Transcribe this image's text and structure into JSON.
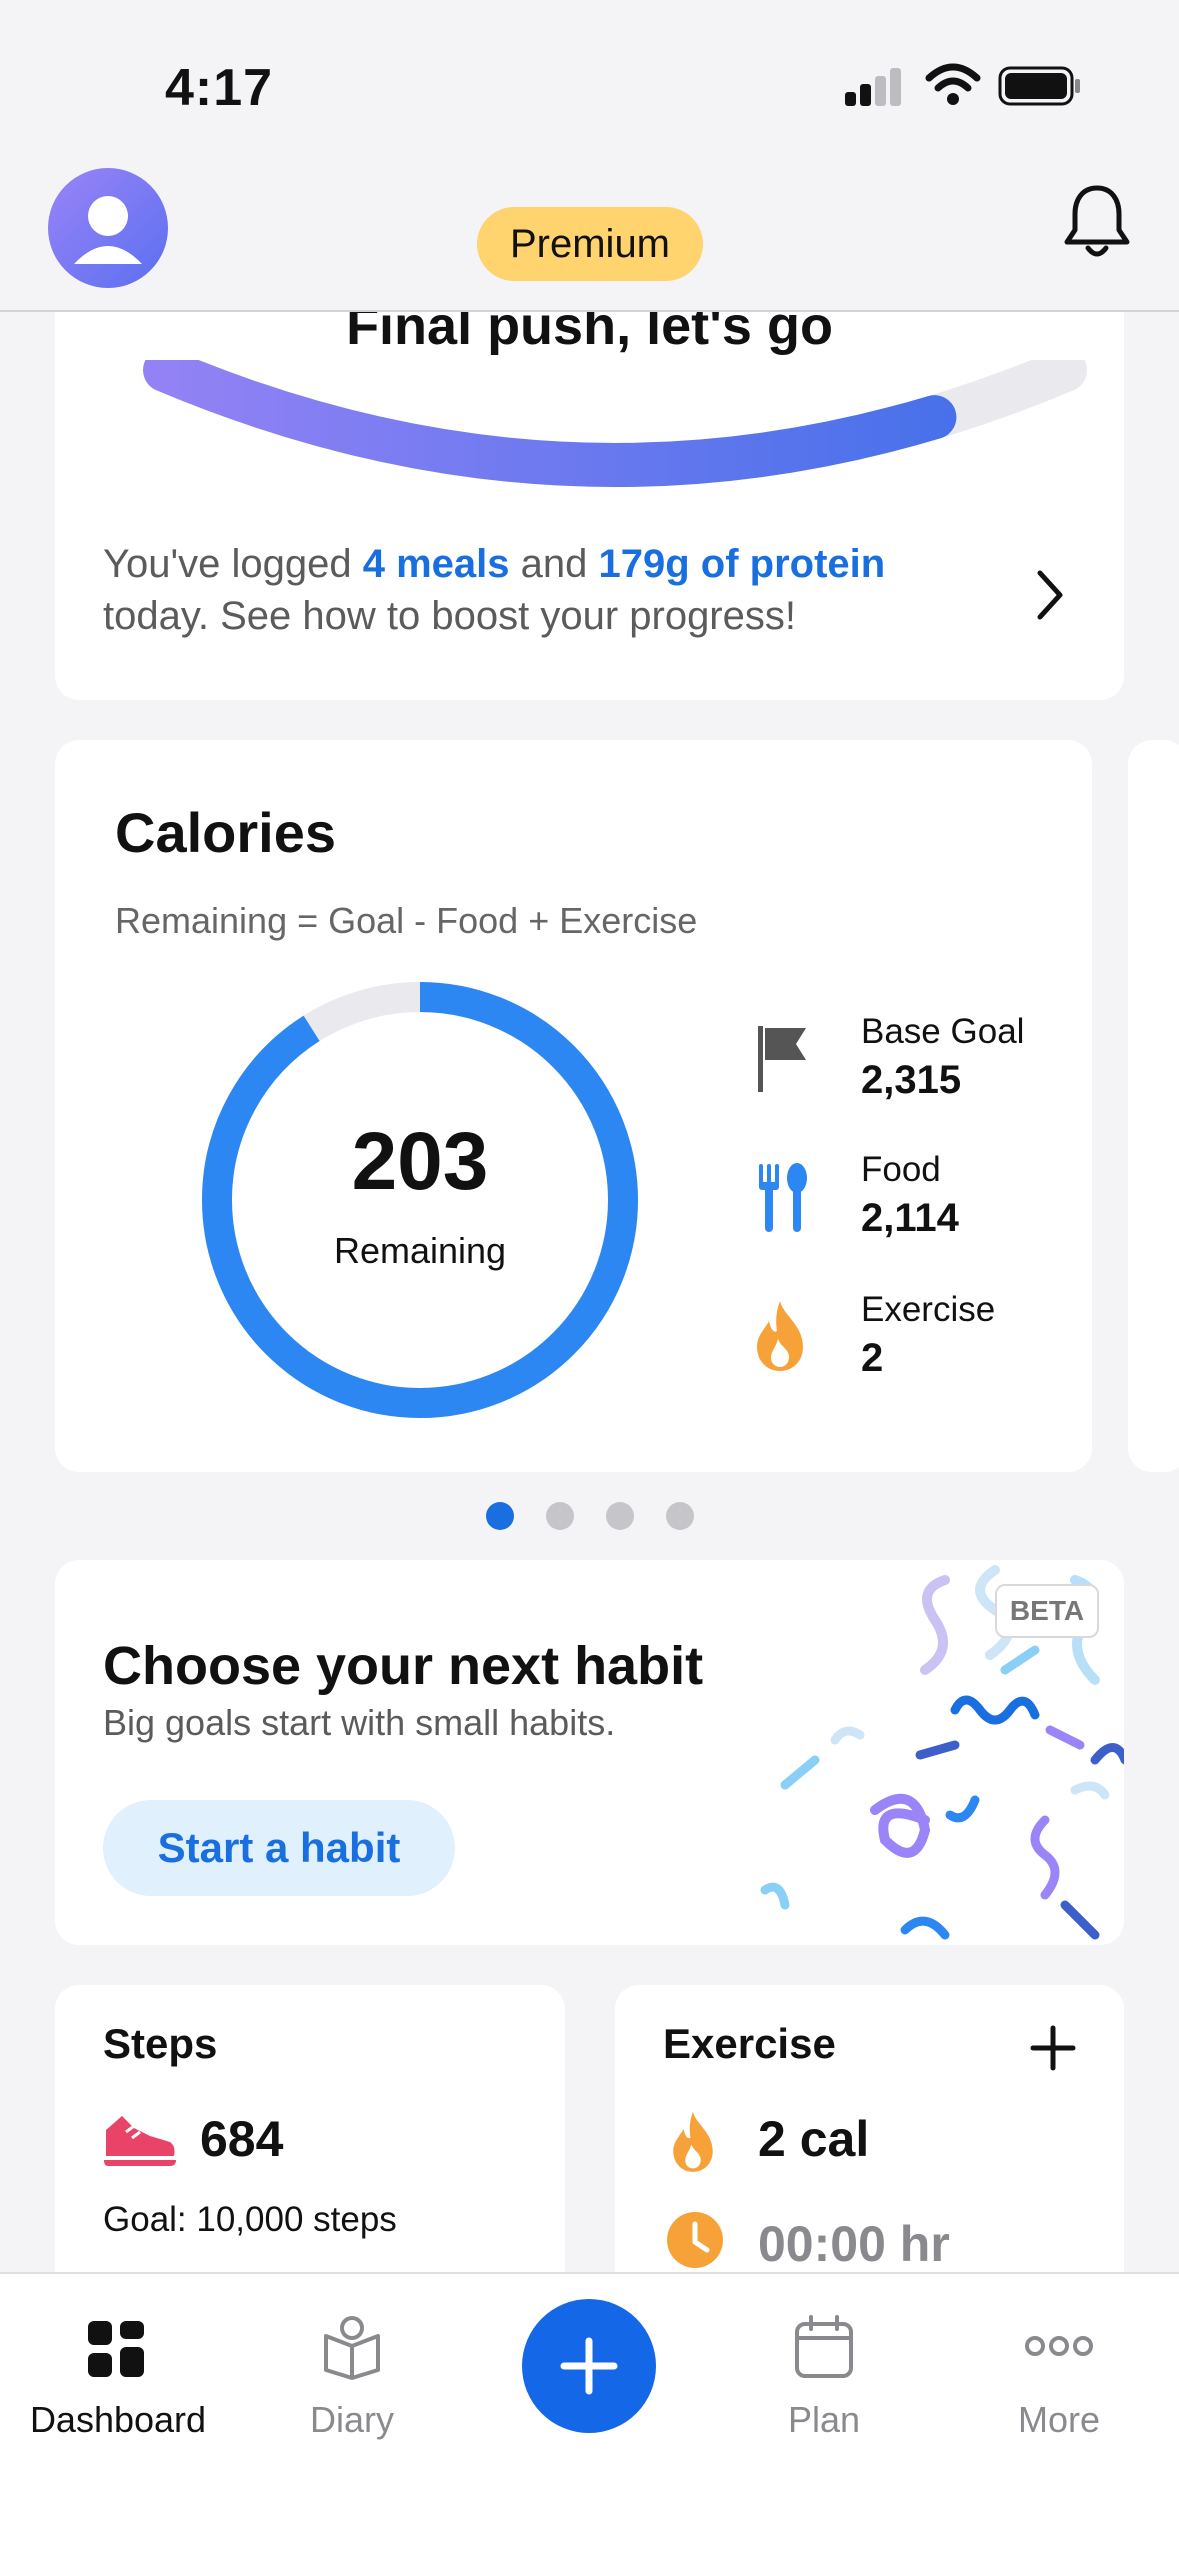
{
  "status_bar": {
    "time": "4:17"
  },
  "header": {
    "premium_label": "Premium"
  },
  "progress_card": {
    "title": "Final push, let's go",
    "progress_fraction": 0.85,
    "text_prefix": "You've logged ",
    "meals": "4 meals",
    "text_mid": " and ",
    "protein": "179g of protein",
    "text_suffix": " today. See how to boost your progress!"
  },
  "calories_card": {
    "title": "Calories",
    "subtitle": "Remaining = Goal - Food + Exercise",
    "remaining_value": "203",
    "remaining_label": "Remaining",
    "ring_fill_fraction": 0.91,
    "colors": {
      "ring": "#2d87f3",
      "track": "#e9e9ee"
    },
    "stats": [
      {
        "label": "Base Goal",
        "value": "2,315",
        "icon": "flag-icon"
      },
      {
        "label": "Food",
        "value": "2,114",
        "icon": "fork-spoon-icon"
      },
      {
        "label": "Exercise",
        "value": "2",
        "icon": "flame-icon"
      }
    ]
  },
  "pagination": {
    "count": 4,
    "active": 0
  },
  "habit_card": {
    "beta_label": "BETA",
    "title": "Choose your next habit",
    "subtitle": "Big goals start with small habits.",
    "button_label": "Start a habit"
  },
  "steps_card": {
    "title": "Steps",
    "value": "684",
    "goal": "Goal: 10,000 steps"
  },
  "exercise_card": {
    "title": "Exercise",
    "calories": "2 cal",
    "duration": "00:00 hr"
  },
  "tab_bar": {
    "tabs": [
      {
        "label": "Dashboard",
        "icon": "dashboard-icon",
        "active": true
      },
      {
        "label": "Diary",
        "icon": "diary-icon",
        "active": false
      },
      {
        "label": "Plan",
        "icon": "calendar-icon",
        "active": false
      },
      {
        "label": "More",
        "icon": "more-icon",
        "active": false
      }
    ],
    "accent": "#1467e6"
  }
}
